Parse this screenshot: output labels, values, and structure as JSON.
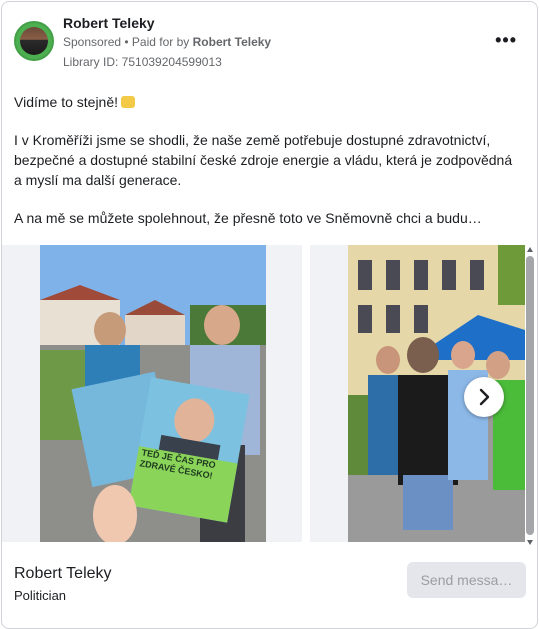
{
  "header": {
    "page_name": "Robert Teleky",
    "sponsored_label": "Sponsored",
    "paid_for_prefix": " • Paid for by ",
    "paid_for_name": "Robert Teleky",
    "library_id": "Library ID: 751039204599013",
    "more_icon": "more-options-icon"
  },
  "post": {
    "paragraphs": [
      "Vidíme to stejně!",
      "I v Kroměříži jsme se shodli, že naše země potřebuje dostupné zdravotnictví, bezpečné a dostupné stabilní české zdroje energie a vládu, která je zodpovědná a myslí ma další generace.",
      "A na mě se můžete spolehnout, že přesně toto ve Sněmovně chci a budu…"
    ],
    "emoji": "handshake-emoji"
  },
  "carousel": {
    "leaflet_text": "TEĎ JE ČAS PRO ZDRAVÉ ČESKO!",
    "next_icon": "chevron-right-icon"
  },
  "footer": {
    "advertiser_name": "Robert Teleky",
    "advertiser_category": "Politician",
    "cta_label": "Send messa…"
  },
  "colors": {
    "accent_green": "#4caf50",
    "leaflet_green": "#8bd45a",
    "button_bg": "#e4e6eb",
    "secondary_text": "#65676b"
  }
}
